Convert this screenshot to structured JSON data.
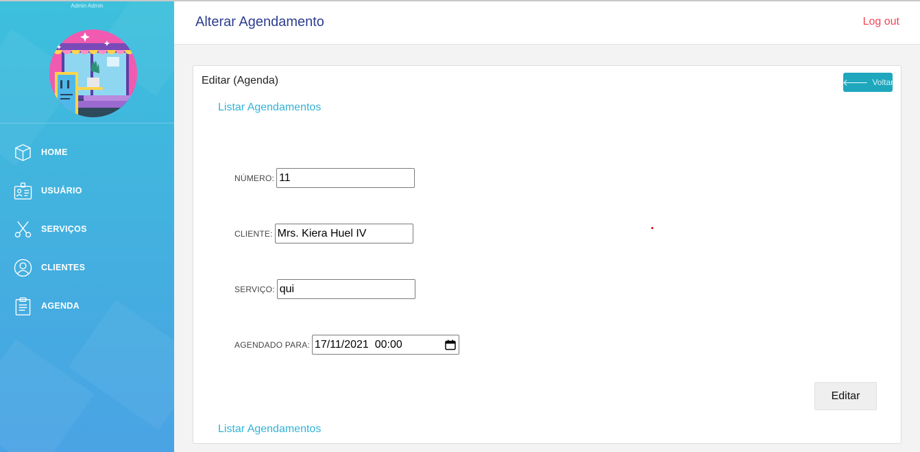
{
  "sidebar": {
    "admin_name": "Admin Admin",
    "items": [
      {
        "label": "HOME",
        "icon": "box-icon"
      },
      {
        "label": "USUÁRIO",
        "icon": "id-card-icon"
      },
      {
        "label": "SERVIÇOS",
        "icon": "scissors-icon"
      },
      {
        "label": "CLIENTES",
        "icon": "user-circle-icon"
      },
      {
        "label": "AGENDA",
        "icon": "clipboard-icon"
      }
    ]
  },
  "header": {
    "title": "Alterar Agendamento",
    "logout": "Log out"
  },
  "card": {
    "title": "Editar (Agenda)",
    "back_button": "Voltar",
    "list_link_top": "Listar Agendamentos",
    "list_link_bottom": "Listar Agendamentos",
    "submit_button": "Editar"
  },
  "form": {
    "numero": {
      "label": "NÚMERO:",
      "value": "11"
    },
    "cliente": {
      "label": "CLIENTE:",
      "value": "Mrs. Kiera Huel IV"
    },
    "servico": {
      "label": "SERVIÇO:",
      "value": "qui"
    },
    "agendado": {
      "label": "AGENDADO PARA:",
      "value": "17/11/2021  00:00"
    }
  },
  "colors": {
    "sidebar_top": "#3cc0dc",
    "sidebar_bottom": "#4aa3e4",
    "title": "#2c3e8f",
    "logout": "#ef4455",
    "link": "#33b2d6",
    "back_button": "#1ea7bd"
  }
}
